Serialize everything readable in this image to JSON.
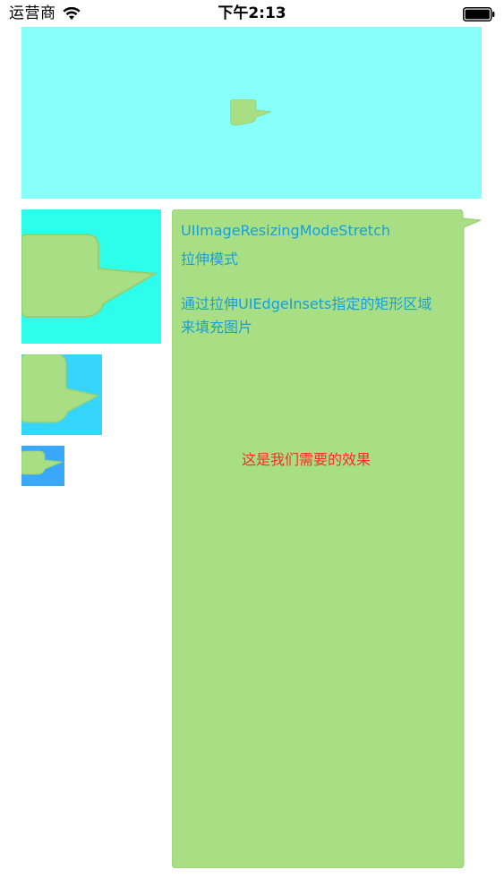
{
  "status_bar": {
    "carrier": "运营商",
    "time": "下午2:13",
    "wifi_icon": "wifi-icon",
    "battery_icon": "battery-icon"
  },
  "colors": {
    "banner_bg": "#88fff9",
    "bubble_green": "#a8de84",
    "thumb_1_bg": "#2dfdeb",
    "thumb_2_bg": "#36d5fb",
    "thumb_3_bg": "#3aa9fb",
    "info_text": "#1a9fd6",
    "effect_text": "#ff2a2a"
  },
  "bubble_panel": {
    "mode_title": "UIImageResizingModeStretch",
    "mode_subtitle": "拉伸模式",
    "description_line_1": "通过拉伸UIEdgeInsets指定的矩形区域",
    "description_line_2": "来填充图片",
    "effect_note": "这是我们需要的效果"
  },
  "icons": {
    "banner_bubble": "chat-bubble-icon",
    "thumb_bubble": "chat-bubble-icon"
  }
}
